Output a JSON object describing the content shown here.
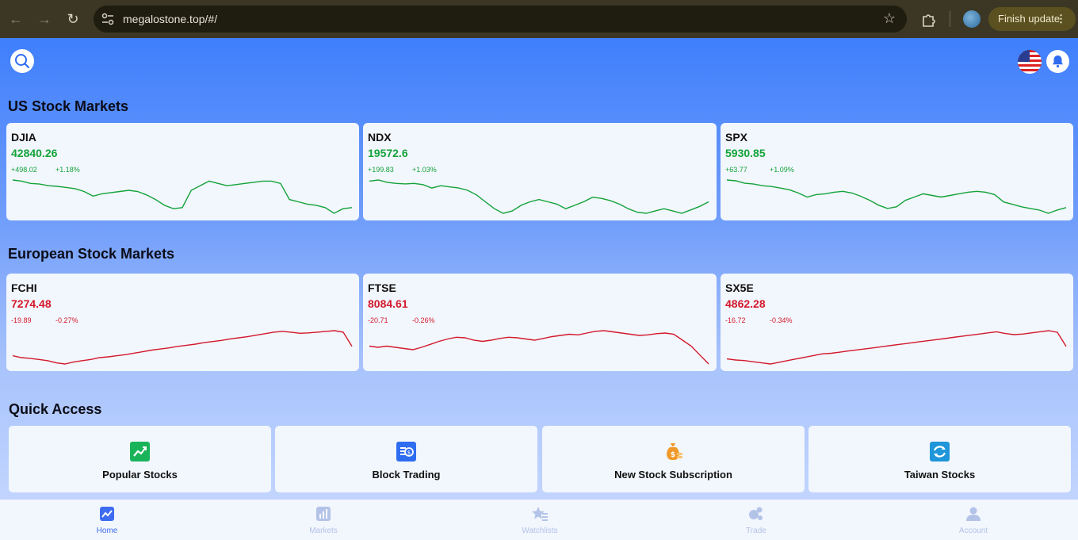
{
  "browser": {
    "url": "megalostone.top/#/",
    "finish_update_label": "Finish update"
  },
  "sections": {
    "us_title": "US Stock Markets",
    "eu_title": "European Stock Markets",
    "quick_title": "Quick Access"
  },
  "us_markets": [
    {
      "symbol": "DJIA",
      "price": "42840.26",
      "change": "+498.02",
      "percent": "+1.18%",
      "trend": "up",
      "spark": [
        42570,
        42560,
        42540,
        42535,
        42520,
        42515,
        42505,
        42495,
        42470,
        42430,
        42450,
        42460,
        42470,
        42480,
        42470,
        42440,
        42400,
        42350,
        42320,
        42330,
        42480,
        42520,
        42560,
        42540,
        42520,
        42530,
        42540,
        42550,
        42560,
        42560,
        42540,
        42400,
        42380,
        42360,
        42350,
        42330,
        42280,
        42320,
        42330
      ]
    },
    {
      "symbol": "NDX",
      "price": "19572.6",
      "change": "+199.83",
      "percent": "+1.03%",
      "trend": "up",
      "spark": [
        19500,
        19505,
        19495,
        19490,
        19488,
        19490,
        19485,
        19470,
        19480,
        19475,
        19470,
        19460,
        19440,
        19410,
        19380,
        19360,
        19370,
        19395,
        19410,
        19420,
        19410,
        19400,
        19380,
        19395,
        19410,
        19430,
        19425,
        19415,
        19400,
        19380,
        19365,
        19360,
        19370,
        19380,
        19370,
        19360,
        19375,
        19390,
        19410
      ]
    },
    {
      "symbol": "SPX",
      "price": "5930.85",
      "change": "+63.77",
      "percent": "+1.09%",
      "trend": "up",
      "spark": [
        5905,
        5904,
        5901,
        5900,
        5898,
        5897,
        5895,
        5893,
        5889,
        5884,
        5887,
        5888,
        5890,
        5891,
        5889,
        5885,
        5880,
        5874,
        5870,
        5872,
        5880,
        5884,
        5888,
        5886,
        5884,
        5886,
        5888,
        5890,
        5891,
        5890,
        5887,
        5878,
        5875,
        5872,
        5870,
        5868,
        5864,
        5868,
        5871
      ]
    }
  ],
  "eu_markets": [
    {
      "symbol": "FCHI",
      "price": "7274.48",
      "change": "-19.89",
      "percent": "-0.27%",
      "trend": "down",
      "spark": [
        7255,
        7250,
        7248,
        7245,
        7242,
        7236,
        7233,
        7238,
        7242,
        7245,
        7250,
        7252,
        7255,
        7258,
        7262,
        7266,
        7270,
        7273,
        7276,
        7280,
        7283,
        7286,
        7290,
        7293,
        7296,
        7300,
        7303,
        7306,
        7310,
        7314,
        7318,
        7320,
        7318,
        7315,
        7316,
        7318,
        7320,
        7322,
        7318,
        7280
      ]
    },
    {
      "symbol": "FTSE",
      "price": "8084.61",
      "change": "-20.71",
      "percent": "-0.26%",
      "trend": "down",
      "spark": [
        8090,
        8088,
        8090,
        8088,
        8086,
        8084,
        8088,
        8093,
        8098,
        8102,
        8105,
        8104,
        8100,
        8098,
        8100,
        8103,
        8105,
        8104,
        8102,
        8100,
        8103,
        8106,
        8108,
        8110,
        8109,
        8112,
        8115,
        8116,
        8114,
        8112,
        8110,
        8108,
        8109,
        8111,
        8112,
        8110,
        8100,
        8090,
        8075,
        8060
      ]
    },
    {
      "symbol": "SX5E",
      "price": "4862.28",
      "change": "-16.72",
      "percent": "-0.34%",
      "trend": "down",
      "spark": [
        4848,
        4846,
        4845,
        4843,
        4841,
        4839,
        4842,
        4845,
        4848,
        4851,
        4854,
        4857,
        4858,
        4860,
        4862,
        4864,
        4866,
        4868,
        4870,
        4872,
        4874,
        4876,
        4878,
        4880,
        4882,
        4884,
        4886,
        4888,
        4890,
        4892,
        4894,
        4896,
        4893,
        4891,
        4892,
        4894,
        4896,
        4898,
        4895,
        4870
      ]
    }
  ],
  "quick_access": [
    {
      "label": "Popular Stocks",
      "icon": "trending-chart-icon",
      "color": "#19b35a"
    },
    {
      "label": "Block Trading",
      "icon": "block-trading-icon",
      "color": "#2f6df0"
    },
    {
      "label": "New Stock Subscription",
      "icon": "money-bag-icon",
      "color": "#f0992a"
    },
    {
      "label": "Taiwan Stocks",
      "icon": "taiwan-exchange-icon",
      "color": "#1f96d9"
    }
  ],
  "tabs": [
    {
      "label": "Home",
      "icon": "home-chart-icon",
      "active": true
    },
    {
      "label": "Markets",
      "icon": "markets-icon",
      "active": false
    },
    {
      "label": "Watchlists",
      "icon": "watchlist-star-icon",
      "active": false
    },
    {
      "label": "Trade",
      "icon": "trade-icon",
      "active": false
    },
    {
      "label": "Account",
      "icon": "account-icon",
      "active": false
    }
  ],
  "colors": {
    "up": "#13a339",
    "down": "#d3192b",
    "accent": "#3d6cf0",
    "inactive_tab": "#b3c3e8"
  }
}
